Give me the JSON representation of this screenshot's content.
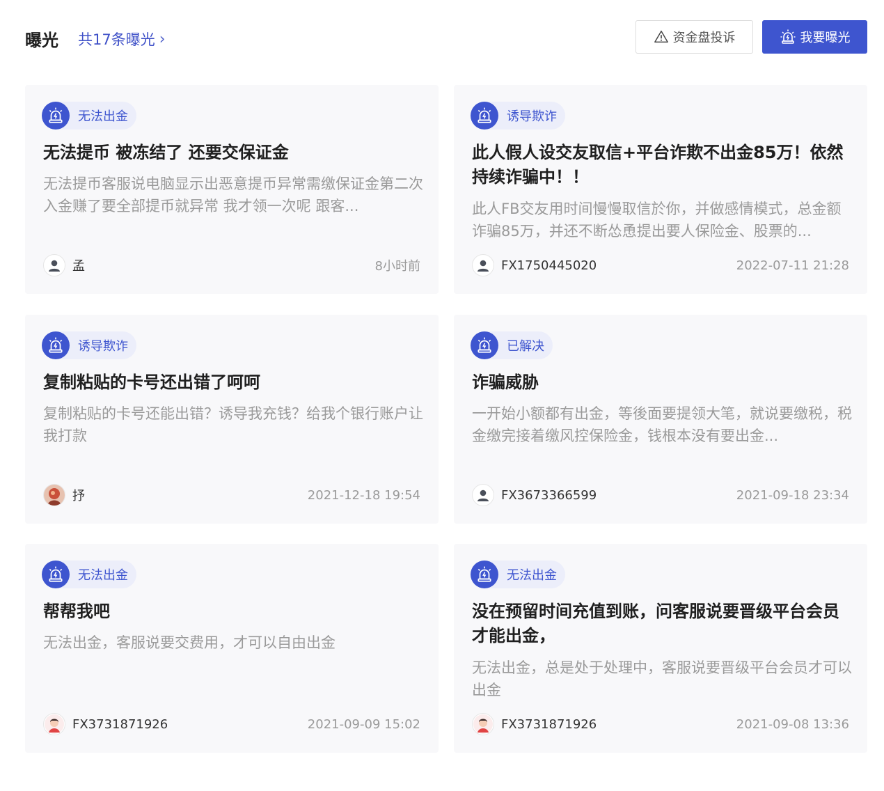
{
  "header": {
    "title": "曝光",
    "count_link": "共17条曝光",
    "complaint_button": "资金盘投诉",
    "expose_button": "我要曝光"
  },
  "cards": [
    {
      "tag": "无法出金",
      "title": "无法提币 被冻结了 还要交保证金",
      "desc": "无法提币客服说电脑显示出恶意提币异常需缴保证金第二次入金赚了要全部提币就异常 我才领一次呢 跟客...",
      "user": "孟",
      "time": "8小时前",
      "avatar": "default-avatar-icon"
    },
    {
      "tag": "诱导欺诈",
      "title": "此人假人设交友取信+平台诈欺不出金85万！依然持续诈骗中！！",
      "desc": "此人FB交友用时间慢慢取信於你，并做感情模式，总金额诈骗85万，并还不断怂恿提出要人保险金、股票的...",
      "user": "FX1750445020",
      "time": "2022-07-11 21:28",
      "avatar": "default-avatar-icon"
    },
    {
      "tag": "诱导欺诈",
      "title": "复制粘贴的卡号还出错了呵呵",
      "desc": "复制粘贴的卡号还能出错？诱导我充钱？给我个银行账户让我打款",
      "user": "抒",
      "time": "2021-12-18 19:54",
      "avatar": "photo-avatar-icon"
    },
    {
      "tag": "已解决",
      "title": "诈骗威胁",
      "desc": "一开始小额都有出金，等後面要提领大笔，就说要缴税，税金缴完接着缴风控保险金，钱根本没有要出金...",
      "user": "FX3673366599",
      "time": "2021-09-18 23:34",
      "avatar": "default-avatar-icon"
    },
    {
      "tag": "无法出金",
      "title": "帮帮我吧",
      "desc": "无法出金，客服说要交费用，才可以自由出金",
      "user": "FX3731871926",
      "time": "2021-09-09 15:02",
      "avatar": "cartoon-avatar-icon"
    },
    {
      "tag": "无法出金",
      "title": "没在预留时间充值到账，问客服说要晋级平台会员才能出金，",
      "desc": "无法出金，总是处于处理中，客服说要晋级平台会员才可以出金",
      "user": "FX3731871926",
      "time": "2021-09-08 13:36",
      "avatar": "cartoon-avatar-icon"
    }
  ],
  "colors": {
    "accent": "#3e55cf",
    "tag_bg": "#eceefa",
    "card_bg": "#f8f8fa",
    "muted_text": "#9a9a9a"
  }
}
